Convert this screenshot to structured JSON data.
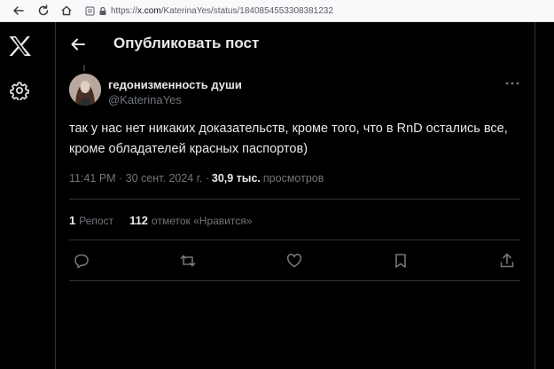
{
  "browser": {
    "url_prefix": "https://",
    "url_host": "x.com",
    "url_path": "/KaterinaYes/status/1840854553308381232"
  },
  "header": {
    "title": "Опубликовать пост"
  },
  "post": {
    "author_name": "гедонизменность души",
    "author_handle": "@KaterinaYes",
    "text": "так у нас нет никаких доказательств, кроме того, что в RnD остались все, кроме обладателей красных паспортов)",
    "time": "11:41 PM · 30 сент. 2024 г. ·",
    "views_count": "30,9 тыс.",
    "views_label": "просмотров"
  },
  "stats": {
    "reposts_count": "1",
    "reposts_label": "Репост",
    "likes_count": "112",
    "likes_label": "отметок «Нравится»"
  },
  "icons": {
    "logo": "x-logo-icon",
    "settings": "settings-gear-icon",
    "back": "arrow-left-icon",
    "more": "more-dots-icon",
    "reply": "reply-icon",
    "repost": "repost-icon",
    "like": "heart-icon",
    "bookmark": "bookmark-icon",
    "share": "share-icon"
  },
  "colors": {
    "background": "#000000",
    "text_primary": "#e7e9ea",
    "text_secondary": "#71767b",
    "border": "#2f3336"
  }
}
